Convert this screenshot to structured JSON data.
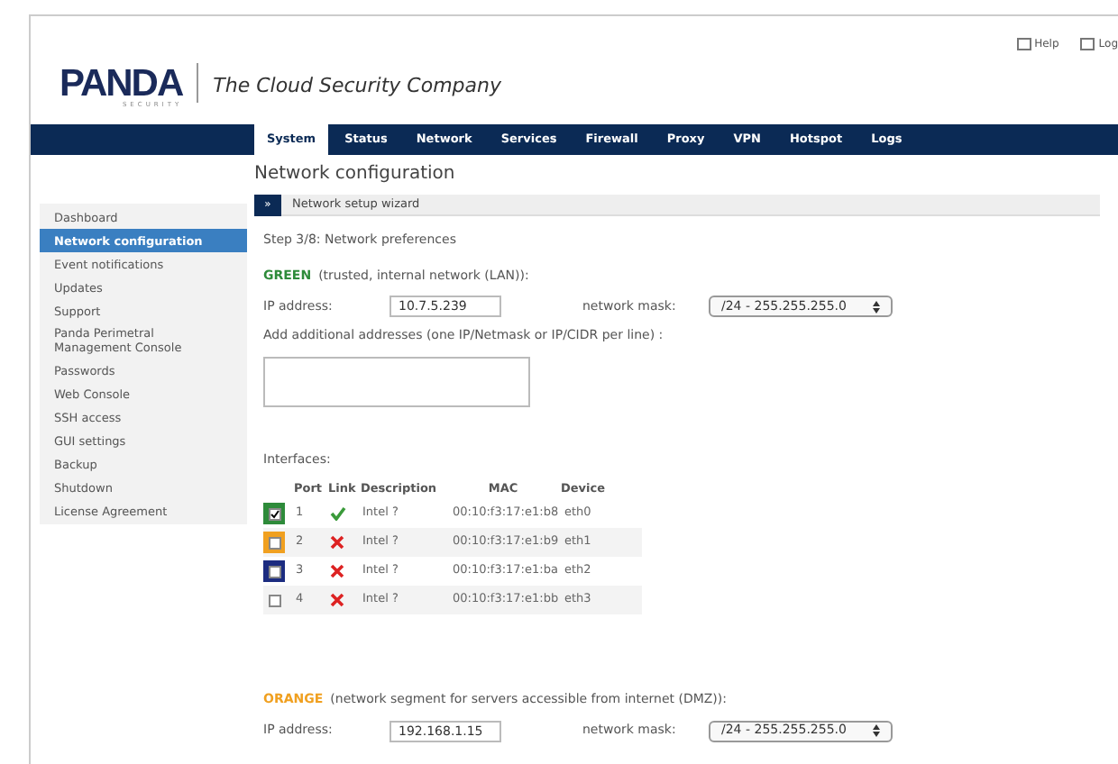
{
  "header": {
    "logo": "PANDA",
    "logo_sub": "SECURITY",
    "tagline": "The Cloud Security Company",
    "links": [
      {
        "label": "Help"
      },
      {
        "label": "Log"
      }
    ]
  },
  "tabs": [
    {
      "label": "System",
      "selected": true
    },
    {
      "label": "Status",
      "selected": false
    },
    {
      "label": "Network",
      "selected": false
    },
    {
      "label": "Services",
      "selected": false
    },
    {
      "label": "Firewall",
      "selected": false
    },
    {
      "label": "Proxy",
      "selected": false
    },
    {
      "label": "VPN",
      "selected": false
    },
    {
      "label": "Hotspot",
      "selected": false
    },
    {
      "label": "Logs",
      "selected": false
    }
  ],
  "page_title": "Network configuration",
  "sidebar": {
    "items": [
      {
        "label": "Dashboard",
        "selected": false
      },
      {
        "label": "Network configuration",
        "selected": true
      },
      {
        "label": "Event notifications",
        "selected": false
      },
      {
        "label": "Updates",
        "selected": false
      },
      {
        "label": "Support",
        "selected": false
      },
      {
        "label": "Panda Perimetral Management Console",
        "selected": false
      },
      {
        "label": "Passwords",
        "selected": false
      },
      {
        "label": "Web Console",
        "selected": false
      },
      {
        "label": "SSH access",
        "selected": false
      },
      {
        "label": "GUI settings",
        "selected": false
      },
      {
        "label": "Backup",
        "selected": false
      },
      {
        "label": "Shutdown",
        "selected": false
      },
      {
        "label": "License Agreement",
        "selected": false
      }
    ]
  },
  "wizard": {
    "toggle": "»",
    "title": "Network setup wizard",
    "step": "Step 3/8: Network preferences",
    "green": {
      "zone": "GREEN",
      "desc": "(trusted, internal network (LAN)):",
      "ip_label": "IP address:",
      "ip": "10.7.5.239",
      "mask_label": "network mask:",
      "mask": "/24 - 255.255.255.0"
    },
    "additional_label": "Add additional addresses (one IP/Netmask or IP/CIDR per line) :",
    "interfaces_label": "Interfaces:",
    "columns": [
      "Port",
      "Link",
      "Description",
      "MAC",
      "Device"
    ],
    "interfaces": [
      {
        "checked": true,
        "color": "#2e8b3a",
        "port": "1",
        "link": true,
        "description": "Intel ?",
        "mac": "00:10:f3:17:e1:b8",
        "device": "eth0"
      },
      {
        "checked": false,
        "color": "#f0a020",
        "port": "2",
        "link": false,
        "description": "Intel ?",
        "mac": "00:10:f3:17:e1:b9",
        "device": "eth1"
      },
      {
        "checked": false,
        "color": "#1c2c80",
        "port": "3",
        "link": false,
        "description": "Intel ?",
        "mac": "00:10:f3:17:e1:ba",
        "device": "eth2"
      },
      {
        "checked": false,
        "port": "4",
        "link": false,
        "description": "Intel ?",
        "mac": "00:10:f3:17:e1:bb",
        "device": "eth3"
      }
    ],
    "orange": {
      "zone": "ORANGE",
      "desc": "(network segment for servers accessible from internet (DMZ)):",
      "ip_label": "IP address:",
      "ip": "192.168.1.15",
      "mask_label": "network mask:",
      "mask": "/24 - 255.255.255.0"
    }
  }
}
